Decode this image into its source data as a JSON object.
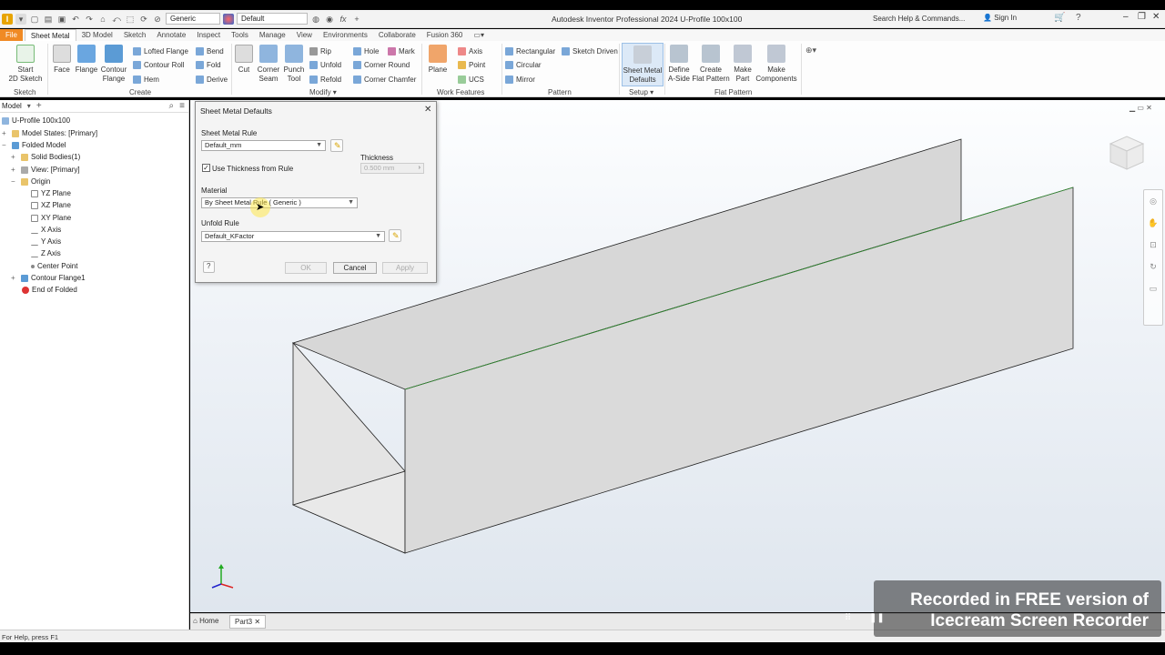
{
  "app": {
    "title": "Autodesk Inventor Professional 2024   U-Profile 100x100",
    "appearance": "Generic",
    "material": "Default",
    "search_placeholder": "Search Help & Commands...",
    "sign_in": "Sign In"
  },
  "tabs": [
    "File",
    "Sheet Metal",
    "3D Model",
    "Sketch",
    "Annotate",
    "Inspect",
    "Tools",
    "Manage",
    "View",
    "Environments",
    "Collaborate",
    "Fusion 360"
  ],
  "ribbon": {
    "sketch": {
      "start": "Start",
      "start2": "2D Sketch",
      "group": "Sketch"
    },
    "create": {
      "face": "Face",
      "flange": "Flange",
      "contour": "Contour",
      "contour2": "Flange",
      "lofted_flange": "Lofted Flange",
      "contour_roll": "Contour Roll",
      "hem": "Hem",
      "bend": "Bend",
      "fold": "Fold",
      "derive": "Derive",
      "group": "Create"
    },
    "modify": {
      "cut": "Cut",
      "corner": "Corner",
      "seam": "Seam",
      "punch": "Punch",
      "tool": "Tool",
      "rip": "Rip",
      "unfold": "Unfold",
      "refold": "Refold",
      "hole": "Hole",
      "corner_round": "Corner Round",
      "corner_chamfer": "Corner Chamfer",
      "mark": "Mark",
      "group": "Modify"
    },
    "work": {
      "plane": "Plane",
      "axis": "Axis",
      "point": "Point",
      "ucs": "UCS",
      "group": "Work Features"
    },
    "pattern": {
      "rectangular": "Rectangular",
      "circular": "Circular",
      "mirror": "Mirror",
      "sketch_driven": "Sketch Driven",
      "group": "Pattern"
    },
    "setup": {
      "sm_defaults": "Sheet Metal",
      "sm_defaults2": "Defaults",
      "group": "Setup"
    },
    "flat": {
      "define": "Define",
      "define2": "A-Side",
      "create": "Create",
      "create2": "Flat Pattern",
      "make_part": "Make",
      "make_part2": "Part",
      "make_comp": "Make",
      "make_comp2": "Components",
      "group": "Flat Pattern"
    }
  },
  "browser": {
    "tab": "Model",
    "items": [
      {
        "label": "U-Profile 100x100"
      },
      {
        "label": "Model States: [Primary]"
      },
      {
        "label": "Folded Model"
      },
      {
        "label": "Solid Bodies(1)"
      },
      {
        "label": "View: [Primary]"
      },
      {
        "label": "Origin"
      },
      {
        "label": "YZ Plane"
      },
      {
        "label": "XZ Plane"
      },
      {
        "label": "XY Plane"
      },
      {
        "label": "X Axis"
      },
      {
        "label": "Y Axis"
      },
      {
        "label": "Z Axis"
      },
      {
        "label": "Center Point"
      },
      {
        "label": "Contour Flange1"
      },
      {
        "label": "End of Folded"
      }
    ]
  },
  "dialog": {
    "title": "Sheet Metal Defaults",
    "rule_label": "Sheet Metal Rule",
    "rule_value": "Default_mm",
    "use_thickness": "Use Thickness from Rule",
    "use_thickness_checked": true,
    "thickness_label": "Thickness",
    "thickness_value": "0.500 mm",
    "material_label": "Material",
    "material_value": "By Sheet Metal Rule ( Generic )",
    "unfold_label": "Unfold Rule",
    "unfold_value": "Default_KFactor",
    "ok": "OK",
    "cancel": "Cancel",
    "apply": "Apply"
  },
  "doc_tabs": {
    "home": "Home",
    "part": "Part3"
  },
  "status": "For Help, press F1",
  "watermark": {
    "line1": "Recorded in FREE version of",
    "line2": "Icecream  Screen  Recorder"
  }
}
